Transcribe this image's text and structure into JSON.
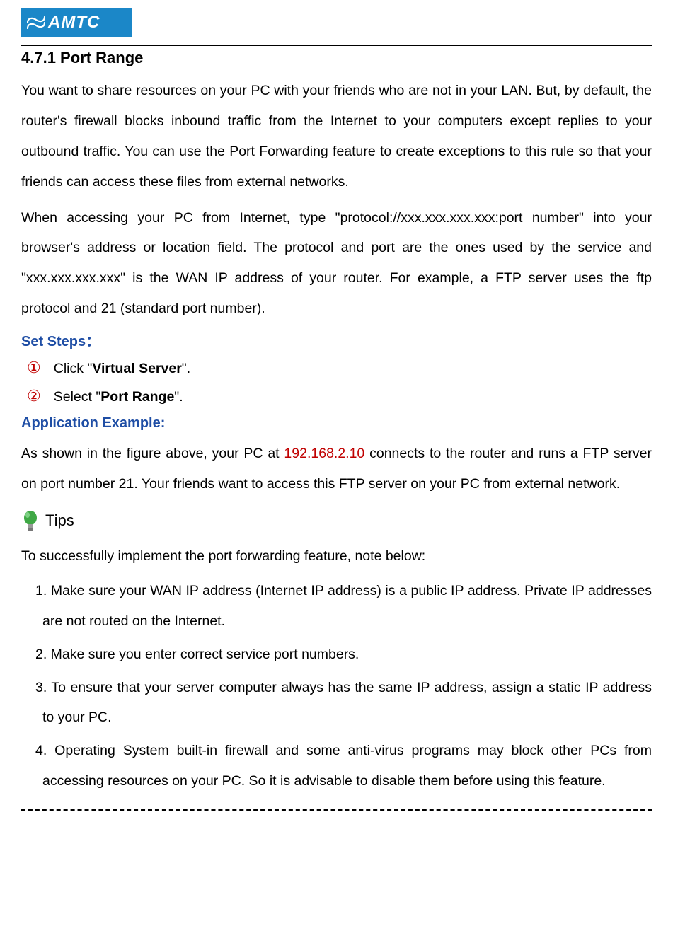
{
  "logo": {
    "text": "AMTC"
  },
  "section_title": "4.7.1 Port Range",
  "para1": "You want to share resources on your PC with your friends who are not in your LAN. But, by default, the router's firewall blocks inbound traffic from the Internet to your computers except replies to your outbound traffic. You can use the Port Forwarding feature to create exceptions to this rule so that your friends can access these files from external networks.",
  "para2": "When accessing your PC from Internet, type \"protocol://xxx.xxx.xxx.xxx:port number\" into your browser's address or location field. The protocol and port are the ones used by the service and \"xxx.xxx.xxx.xxx\" is the WAN IP address of your router. For example, a FTP server uses the ftp protocol and 21 (standard port number).",
  "set_steps_label": "Set Steps：",
  "steps": [
    {
      "num": "①",
      "pre": "Click \"",
      "bold": "Virtual Server",
      "post": "\"."
    },
    {
      "num": "②",
      "pre": "Select \"",
      "bold": "Port Range",
      "post": "\"."
    }
  ],
  "app_example_label": "Application Example:",
  "app_example_pre": "As shown in the figure above, your PC at ",
  "app_example_ip": "192.168.2.10",
  "app_example_post": " connects to the router and runs a FTP server on port number 21. Your friends want to access this FTP server on your PC from external network.",
  "tips_label": "Tips",
  "tips_intro": "To successfully implement the port forwarding feature, note below:",
  "tips": [
    "1. Make sure your WAN IP address (Internet IP address) is a public IP address. Private IP addresses are not routed on the Internet.",
    "2. Make sure you enter correct service port numbers.",
    "3. To ensure that your server computer always has the same IP address, assign a static IP address to your PC.",
    "4. Operating System built-in firewall and some anti-virus programs may block other PCs from accessing resources on your PC. So it is advisable to disable them before using this feature."
  ]
}
